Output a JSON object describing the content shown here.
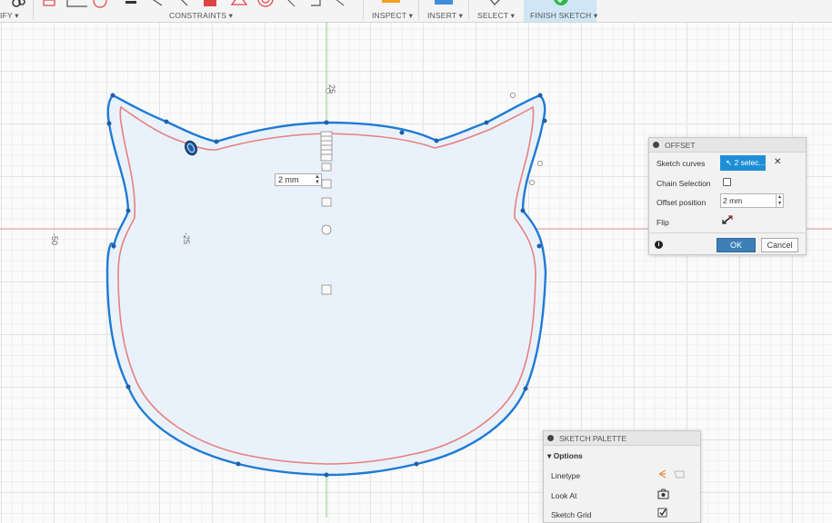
{
  "toolbar": {
    "modify_label": "IFY ▾",
    "constraints_label": "CONSTRAINTS ▾",
    "inspect_label": "INSPECT ▾",
    "insert_label": "INSERT ▾",
    "select_label": "SELECT ▾",
    "finish_sketch_label": "FINISH SKETCH ▾",
    "finish_sketch_color": "#cfe6f5"
  },
  "canvas": {
    "grid_labels": {
      "x_top": "25",
      "x_neg50": "-50",
      "x_neg25": "-25"
    },
    "dimension_input_value": "2 mm",
    "colors": {
      "outline": "#1f7ad6",
      "offset_curve": "#e8807e",
      "fill": "#e9f2fa",
      "axis_red": "#e89a9a",
      "axis_green": "#8bd18b"
    }
  },
  "offset_dialog": {
    "title": "OFFSET",
    "sketch_curves_label": "Sketch curves",
    "selection_button": "2 selec...",
    "chain_selection_label": "Chain Selection",
    "chain_selection_checked": false,
    "offset_position_label": "Offset position",
    "offset_value": "2 mm",
    "flip_label": "Flip",
    "ok_label": "OK",
    "cancel_label": "Cancel"
  },
  "sketch_palette": {
    "title": "SKETCH PALETTE",
    "section_label": "▾ Options",
    "items": [
      {
        "label": "Linetype",
        "icon": "linetype-icon"
      },
      {
        "label": "Look At",
        "icon": "look-at-icon"
      },
      {
        "label": "Sketch Grid",
        "icon": "checkbox-checked-icon",
        "checked": true
      }
    ]
  }
}
